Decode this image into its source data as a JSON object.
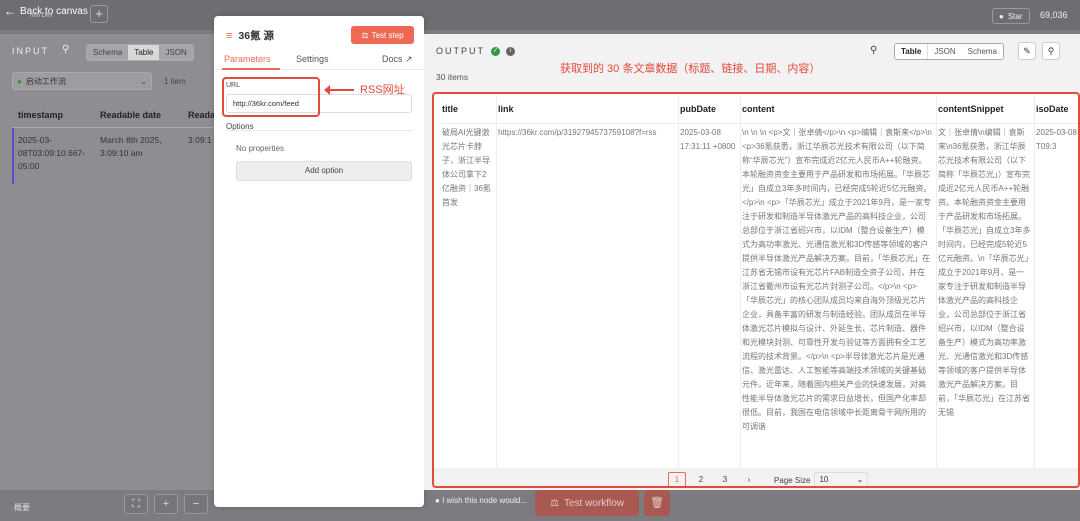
{
  "topbar": {
    "back_label": "Back to canvas",
    "workflow_sub": "n8n Dev",
    "plus": "+",
    "star_label": "Star",
    "star_count": "69,036"
  },
  "input_panel": {
    "heading": "INPUT",
    "view_tabs": [
      "Schema",
      "Table",
      "JSON"
    ],
    "active_view": "Table",
    "workflow_select": "启动工作流",
    "item_count": "1 item",
    "columns": [
      "timestamp",
      "Readable date",
      "Reada"
    ],
    "row": [
      "2025-03-08T03:09:10.667-05:00",
      "March 8th 2025, 3:09:10 am",
      "3:09:1"
    ]
  },
  "node": {
    "title": "36氪 源",
    "test_step_label": "Test step",
    "tabs": [
      "Parameters",
      "Settings"
    ],
    "docs_label": "Docs",
    "url_label": "URL",
    "url_value": "http://36kr.com/feed",
    "rss_annotation": "RSS网址",
    "options_heading": "Options",
    "no_properties": "No properties",
    "add_option_label": "Add option"
  },
  "output_panel": {
    "heading": "OUTPUT",
    "item_count": "30 items",
    "annotation": "获取到的 30 条文章数据（标题、链接、日期、内容）",
    "view_tabs": [
      "Table",
      "JSON",
      "Schema"
    ],
    "active_view": "Table",
    "columns": [
      "title",
      "link",
      "pubDate",
      "content",
      "contentSnippet",
      "isoDate"
    ],
    "row": {
      "title": "破局AI光键激光芯片卡脖子，浙江半导体公司拿下2亿融资｜36氪首发",
      "link": "https://36kr.com/p/3192794573759108?f=rss",
      "pubDate": "2025-03-08 17:31:11 +0800",
      "content": "\\n \\n \\n <p>文｜张卓倩</p>\\n <p>编辑｜袁斯来</p>\\n <p>36氪获悉，浙江华辰芯光技术有限公司（以下简称“华辰芯光”）宣布完成近2亿元人民币A++轮融资。本轮融资资金主要用于产品研发和市场拓展。「华辰芯光」自成立3年多时间内，已经完成5轮近5亿元融资。</p>\\n <p>「华辰芯光」成立于2021年9月，是一家专注于研发和制造半导体激光产品的高科技企业，公司总部位于浙江省绍兴市，以IDM（整合设备生产）模式为高功率激光、光通信激光和3D传感等领域的客户提供半导体激光产品解决方案。目前，「华辰芯光」在江苏省无锡市设有光芯片FAB制造全资子公司，并在浙江省衢州市设有光芯片封测子公司。</p>\\n <p>「华辰芯光」的核心团队成员均来自海外顶级光芯片企业，具备丰富的研发与制造经验。团队成员在半导体激光芯片模拟与设计、外延生长、芯片制造、器件和光模块封测、可靠性开发与验证等方面拥有全工艺流程的技术背景。</p>\\n <p>半导体激光芯片是光通信、激光雷达、人工智能等高端技术领域的关键基础元件。近年来，随着国内相关产业的快速发展，对高性能半导体激光芯片的需求日益增长，但国产化率却很低。目前，我国在电信领域中长距离骨干网所用的可调谐",
      "contentSnippet": "文｜张卓倩\\n编辑｜袁斯来\\n36氪获悉，浙江华辰芯光技术有限公司（以下简称「华辰芯光」）宣布完成近2亿元人民币A++轮融资。本轮融资资金主要用于产品研发和市场拓展。「华辰芯光」自成立3年多时间内，已经完成5轮近5亿元融资。\\n「华辰芯光」成立于2021年9月，是一家专注于研发和制造半导体激光产品的高科技企业，公司总部位于浙江省绍兴市，以IDM（整合设备生产）模式为高功率激光、光通信激光和3D传感等领域的客户提供半导体激光产品解决方案。目前，「华辰芯光」在江苏省无锡",
      "isoDate": "2025-03-08T09:3"
    },
    "pagination": {
      "pages": [
        "1",
        "2",
        "3"
      ],
      "current": "1",
      "next": "›",
      "page_size_label": "Page Size",
      "page_size": "10"
    }
  },
  "bottom": {
    "left_label": "概要",
    "wish_label": "I wish this node would...",
    "test_workflow_label": "Test workflow"
  },
  "colors": {
    "accent": "#ee6a57",
    "annotation_red": "#e24a3a",
    "rss_orange": "#e8762e",
    "success": "#2f9a45"
  }
}
